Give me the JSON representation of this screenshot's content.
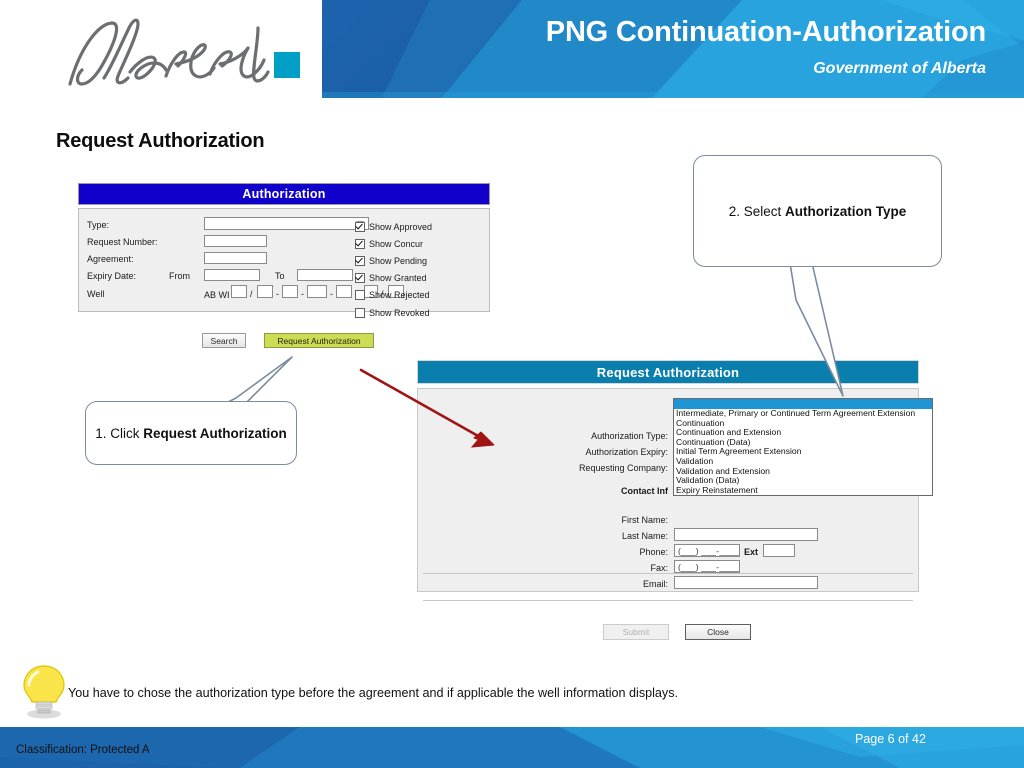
{
  "header": {
    "title": "PNG Continuation-Authorization",
    "subtitle": "Government of Alberta",
    "logo_text": "Alberta"
  },
  "slide": {
    "title": "Request Authorization"
  },
  "auth_panel": {
    "header": "Authorization",
    "fields": {
      "type_label": "Type:",
      "type_value": "",
      "request_number_label": "Request Number:",
      "request_number_value": "",
      "agreement_label": "Agreement:",
      "agreement_value": "",
      "expiry_date_label": "Expiry Date:",
      "from_label": "From",
      "from_value": "",
      "to_label": "To",
      "to_value": "",
      "well_label": "Well",
      "well_prefix": "AB WI",
      "well_sep_slash": "/",
      "well_sep_dash": "-",
      "well_w": "W"
    },
    "checkboxes": [
      {
        "label": "Show Approved",
        "checked": true
      },
      {
        "label": "Show Concur",
        "checked": true
      },
      {
        "label": "Show Pending",
        "checked": true
      },
      {
        "label": "Show Granted",
        "checked": true
      },
      {
        "label": "Show Rejected",
        "checked": false
      },
      {
        "label": "Show Revoked",
        "checked": false
      }
    ],
    "buttons": {
      "search": "Search",
      "request_authorization": "Request Authorization"
    }
  },
  "request_panel": {
    "header": "Request Authorization",
    "labels": {
      "authorization_type": "Authorization Type:",
      "authorization_expiry": "Authorization Expiry:",
      "requesting_company": "Requesting Company:",
      "contact_information": "Contact Inf",
      "first_name": "First Name:",
      "last_name": "Last Name:",
      "phone": "Phone:",
      "ext": "Ext",
      "fax": "Fax:",
      "email": "Email:"
    },
    "values": {
      "last_name": "",
      "phone": "(___) ___-____",
      "ext": "",
      "fax": "(___) ___-____",
      "email": ""
    },
    "buttons": {
      "submit": "Submit",
      "close": "Close"
    }
  },
  "dropdown": {
    "selected": "",
    "options": [
      "Intermediate, Primary or Continued Term Agreement Extension",
      "Continuation",
      "Continuation and Extension",
      "Continuation (Data)",
      "Initial Term Agreement Extension",
      "Validation",
      "Validation and Extension",
      "Validation (Data)",
      "Expiry Reinstatement"
    ]
  },
  "callouts": {
    "step1_prefix": "1. Click ",
    "step1_bold": "Request Authorization",
    "step2_prefix": "2.  Select ",
    "step2_bold": "Authorization Type"
  },
  "tip": {
    "text": "You have to chose the authorization type before the agreement and if applicable the well information displays."
  },
  "footer": {
    "classification": "Classification: Protected A",
    "page": "Page 6 of 42"
  },
  "colors": {
    "header_blue": "#1b74bd",
    "header_light_blue": "#29a3dd",
    "auth_title_blue": "#1100cc",
    "request_header_teal": "#0a7fae",
    "request_button_green": "#ccdd55",
    "arrow_red": "#a01414",
    "dropdown_highlight": "#2095d6",
    "callout_border": "#7b8c9e"
  }
}
